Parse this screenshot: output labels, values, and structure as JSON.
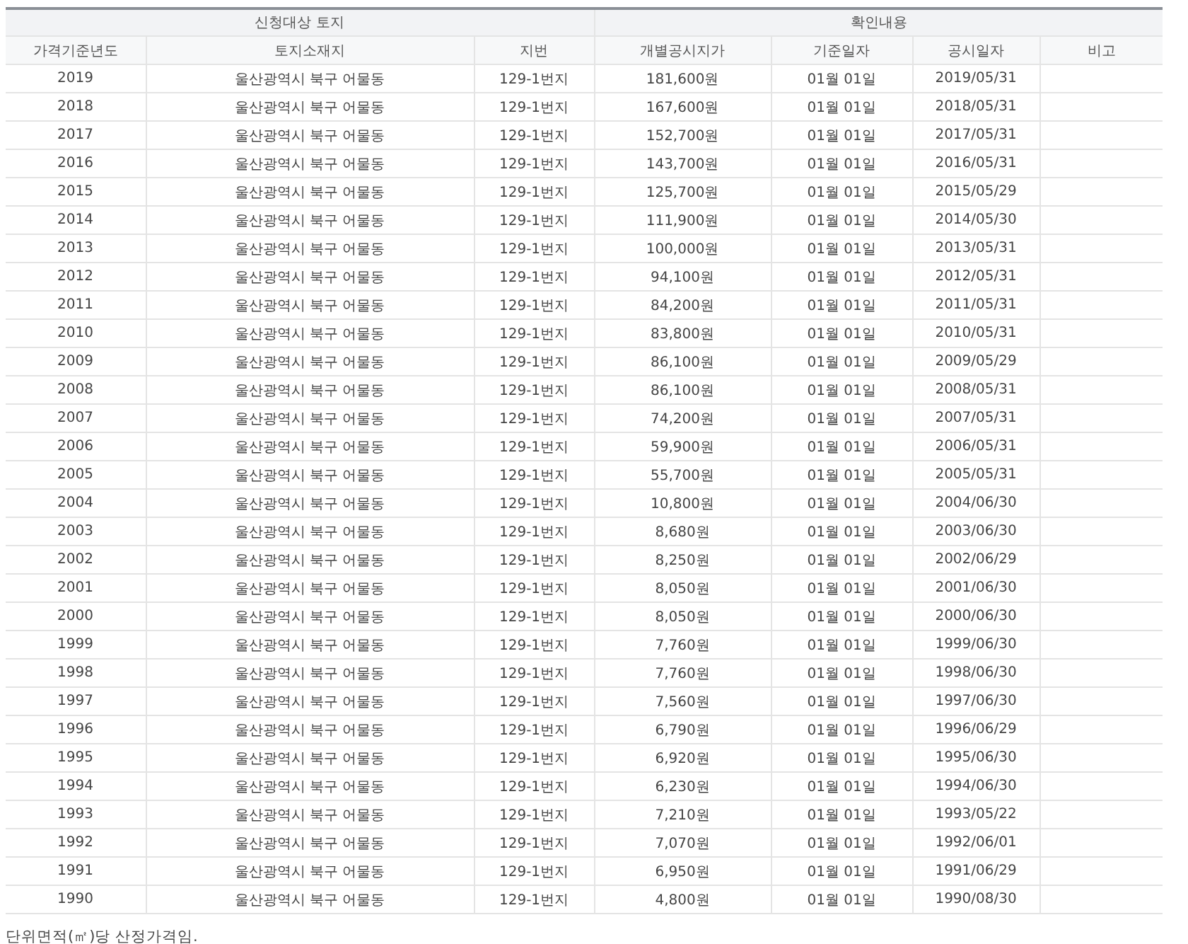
{
  "table": {
    "groups": [
      {
        "label": "신청대상 토지",
        "columns": [
          "가격기준년도",
          "토지소재지",
          "지번"
        ]
      },
      {
        "label": "확인내용",
        "columns": [
          "개별공시지가",
          "기준일자",
          "공시일자",
          "비고"
        ]
      }
    ],
    "rows": [
      [
        "2019",
        "울산광역시 북구 어물동",
        "129-1번지",
        "181,600원",
        "01월 01일",
        "2019/05/31"
      ],
      [
        "2018",
        "울산광역시 북구 어물동",
        "129-1번지",
        "167,600원",
        "01월 01일",
        "2018/05/31"
      ],
      [
        "2017",
        "울산광역시 북구 어물동",
        "129-1번지",
        "152,700원",
        "01월 01일",
        "2017/05/31"
      ],
      [
        "2016",
        "울산광역시 북구 어물동",
        "129-1번지",
        "143,700원",
        "01월 01일",
        "2016/05/31"
      ],
      [
        "2015",
        "울산광역시 북구 어물동",
        "129-1번지",
        "125,700원",
        "01월 01일",
        "2015/05/29"
      ],
      [
        "2014",
        "울산광역시 북구 어물동",
        "129-1번지",
        "111,900원",
        "01월 01일",
        "2014/05/30"
      ],
      [
        "2013",
        "울산광역시 북구 어물동",
        "129-1번지",
        "100,000원",
        "01월 01일",
        "2013/05/31"
      ],
      [
        "2012",
        "울산광역시 북구 어물동",
        "129-1번지",
        "94,100원",
        "01월 01일",
        "2012/05/31"
      ],
      [
        "2011",
        "울산광역시 북구 어물동",
        "129-1번지",
        "84,200원",
        "01월 01일",
        "2011/05/31"
      ],
      [
        "2010",
        "울산광역시 북구 어물동",
        "129-1번지",
        "83,800원",
        "01월 01일",
        "2010/05/31"
      ],
      [
        "2009",
        "울산광역시 북구 어물동",
        "129-1번지",
        "86,100원",
        "01월 01일",
        "2009/05/29"
      ],
      [
        "2008",
        "울산광역시 북구 어물동",
        "129-1번지",
        "86,100원",
        "01월 01일",
        "2008/05/31"
      ],
      [
        "2007",
        "울산광역시 북구 어물동",
        "129-1번지",
        "74,200원",
        "01월 01일",
        "2007/05/31"
      ],
      [
        "2006",
        "울산광역시 북구 어물동",
        "129-1번지",
        "59,900원",
        "01월 01일",
        "2006/05/31"
      ],
      [
        "2005",
        "울산광역시 북구 어물동",
        "129-1번지",
        "55,700원",
        "01월 01일",
        "2005/05/31"
      ],
      [
        "2004",
        "울산광역시 북구 어물동",
        "129-1번지",
        "10,800원",
        "01월 01일",
        "2004/06/30"
      ],
      [
        "2003",
        "울산광역시 북구 어물동",
        "129-1번지",
        "8,680원",
        "01월 01일",
        "2003/06/30"
      ],
      [
        "2002",
        "울산광역시 북구 어물동",
        "129-1번지",
        "8,250원",
        "01월 01일",
        "2002/06/29"
      ],
      [
        "2001",
        "울산광역시 북구 어물동",
        "129-1번지",
        "8,050원",
        "01월 01일",
        "2001/06/30"
      ],
      [
        "2000",
        "울산광역시 북구 어물동",
        "129-1번지",
        "8,050원",
        "01월 01일",
        "2000/06/30"
      ],
      [
        "1999",
        "울산광역시 북구 어물동",
        "129-1번지",
        "7,760원",
        "01월 01일",
        "1999/06/30"
      ],
      [
        "1998",
        "울산광역시 북구 어물동",
        "129-1번지",
        "7,760원",
        "01월 01일",
        "1998/06/30"
      ],
      [
        "1997",
        "울산광역시 북구 어물동",
        "129-1번지",
        "7,560원",
        "01월 01일",
        "1997/06/30"
      ],
      [
        "1996",
        "울산광역시 북구 어물동",
        "129-1번지",
        "6,790원",
        "01월 01일",
        "1996/06/29"
      ],
      [
        "1995",
        "울산광역시 북구 어물동",
        "129-1번지",
        "6,920원",
        "01월 01일",
        "1995/06/30"
      ],
      [
        "1994",
        "울산광역시 북구 어물동",
        "129-1번지",
        "6,230원",
        "01월 01일",
        "1994/06/30"
      ],
      [
        "1993",
        "울산광역시 북구 어물동",
        "129-1번지",
        "7,210원",
        "01월 01일",
        "1993/05/22"
      ],
      [
        "1992",
        "울산광역시 북구 어물동",
        "129-1번지",
        "7,070원",
        "01월 01일",
        "1992/06/01"
      ],
      [
        "1991",
        "울산광역시 북구 어물동",
        "129-1번지",
        "6,950원",
        "01월 01일",
        "1991/06/29"
      ],
      [
        "1990",
        "울산광역시 북구 어물동",
        "129-1번지",
        "4,800원",
        "01월 01일",
        "1990/08/30"
      ]
    ]
  },
  "footnote": "단위면적(㎡)당 산정가격임."
}
